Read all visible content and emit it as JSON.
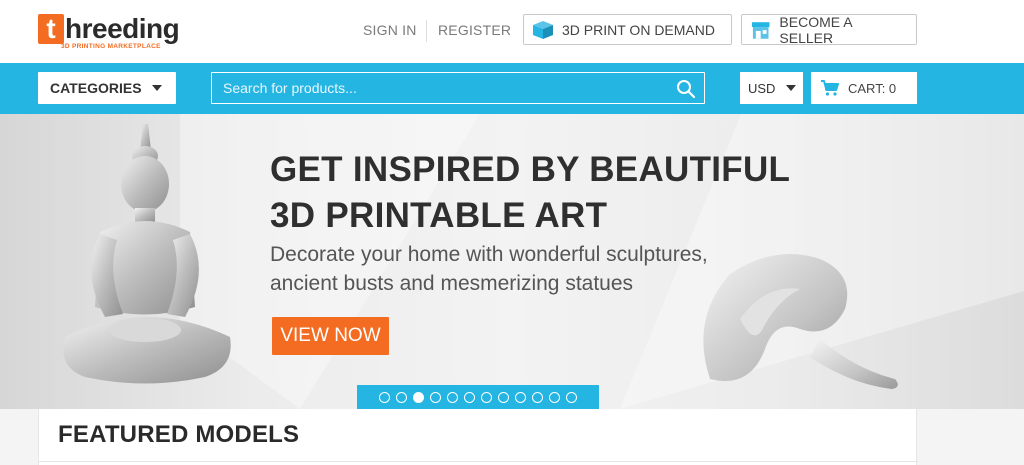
{
  "logo": {
    "first_letter": "t",
    "rest": "hreeding",
    "tagline": "3D PRINTING MARKETPLACE"
  },
  "header": {
    "sign_in": "SIGN IN",
    "register": "REGISTER",
    "print_on_demand": "3D PRINT ON DEMAND",
    "become_seller": "BECOME A SELLER"
  },
  "nav": {
    "categories": "CATEGORIES",
    "search_placeholder": "Search for products...",
    "currency": "USD",
    "cart": "CART: 0"
  },
  "hero": {
    "title_line1": "GET INSPIRED BY BEAUTIFUL",
    "title_line2": "3D PRINTABLE ART",
    "subtitle_line1": "Decorate your home with wonderful sculptures,",
    "subtitle_line2": "ancient busts and mesmerizing statues",
    "cta": "VIEW NOW",
    "slides_total": 12,
    "active_slide": 3
  },
  "featured": {
    "title": "FEATURED MODELS"
  },
  "colors": {
    "accent_blue": "#25b5e3",
    "accent_orange": "#f36c21"
  },
  "icons": [
    "box-3d-icon",
    "storefront-icon",
    "search-icon",
    "cart-icon",
    "caret-down-icon"
  ]
}
